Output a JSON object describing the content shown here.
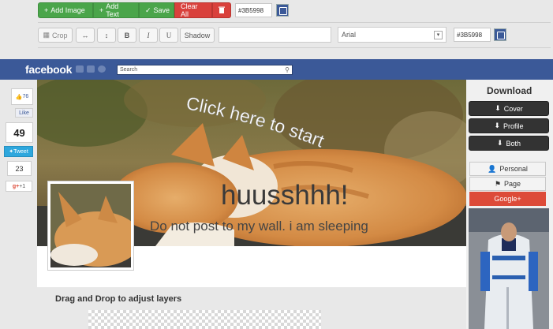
{
  "toolbar": {
    "add_image": "Add Image",
    "add_text": "Add Text",
    "save": "Save",
    "clear_all": "Clear All",
    "color_hex_1": "#3B5998",
    "crop": "Crop",
    "bold": "B",
    "italic": "I",
    "underline": "U",
    "shadow": "Shadow",
    "font": "Arial",
    "color_hex_2": "#3B5998",
    "accent_green": "#4aa54a",
    "accent_red": "#d9413c"
  },
  "facebook": {
    "logo": "facebook",
    "search_placeholder": "Search",
    "brand_color": "#3b5998"
  },
  "social": {
    "like_count": "76",
    "like_label": "Like",
    "share_count": "49",
    "tweet_label": "Tweet",
    "tweet_count": "23",
    "gplus_label": "+1"
  },
  "cover": {
    "click_text": "Click here to start",
    "headline": "huusshhh!",
    "subline": "Do not post to my wall. i am sleeping"
  },
  "download": {
    "title": "Download",
    "cover": "Cover",
    "profile": "Profile",
    "both": "Both",
    "personal": "Personal",
    "page": "Page",
    "google": "Google+"
  },
  "layers": {
    "title": "Drag and Drop to adjust layers"
  }
}
